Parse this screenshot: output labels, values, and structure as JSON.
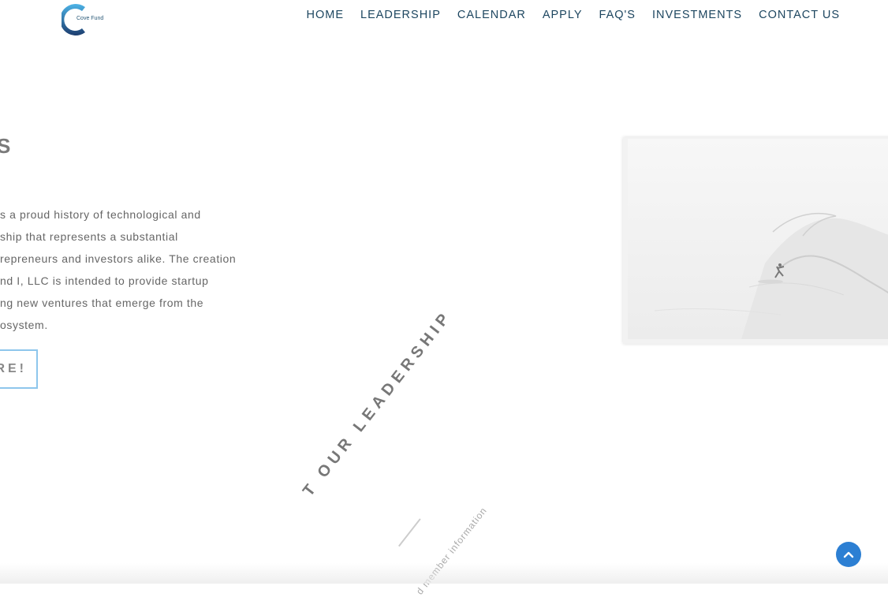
{
  "brand": {
    "logo_text": "Cove Fund",
    "logo_colors": [
      "#4db3e6",
      "#1c3d6e"
    ]
  },
  "nav": {
    "items": [
      {
        "label": "HOME"
      },
      {
        "label": "LEADERSHIP"
      },
      {
        "label": "CALENDAR"
      },
      {
        "label": "APPLY"
      },
      {
        "label": "FAQ'S"
      },
      {
        "label": "INVESTMENTS"
      },
      {
        "label": "CONTACT US"
      }
    ],
    "color": "#1d4660"
  },
  "hero": {
    "heading_fragment": "S",
    "paragraph_lines": [
      "s a proud history of technological and",
      "ship that represents a substantial",
      "repreneurs and investors alike. The creation",
      "nd I, LLC is intended to provide startup",
      "ng new ventures that emerge from the",
      "osystem."
    ],
    "cta_label_fragment": "RE!",
    "cta_border_color": "#8ec6ec",
    "image_icon": "surfer-wave-image"
  },
  "leadership_section": {
    "title_fragment": "T OUR LEADERSHIP",
    "subtitle_fragment": "d member information"
  },
  "scroll_top": {
    "icon": "chevron-up-icon",
    "color": "#2c7fd3"
  }
}
